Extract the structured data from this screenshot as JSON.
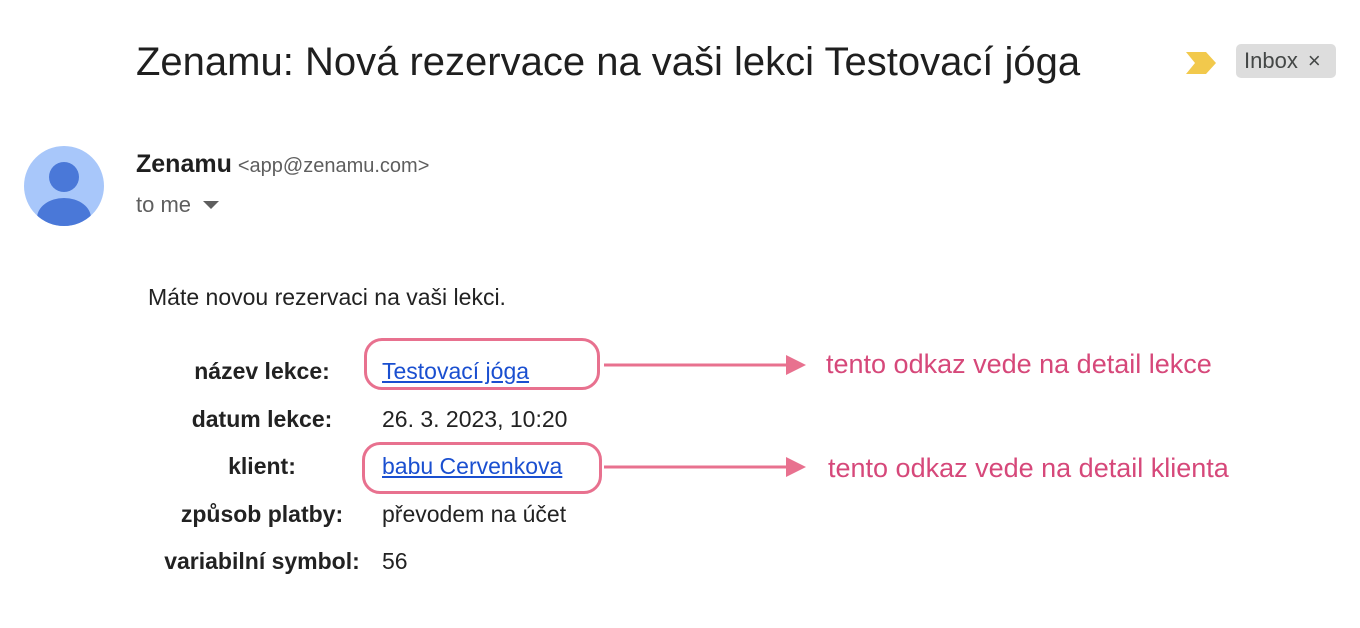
{
  "email": {
    "subject": "Zenamu: Nová rezervace na vaši lekci Testovací jóga",
    "label_chip": {
      "text": "Inbox",
      "close": "×"
    },
    "sender": {
      "name": "Zenamu",
      "email": "<app@zenamu.com>"
    },
    "recipient": "to me",
    "body": {
      "intro": "Máte novou rezervaci na vaši lekci.",
      "details": [
        {
          "label": "název lekce:",
          "value": "Testovací jóga",
          "link": true
        },
        {
          "label": "datum lekce:",
          "value": "26. 3. 2023, 10:20",
          "link": false
        },
        {
          "label": "klient:",
          "value": "babu Cervenkova",
          "link": true
        },
        {
          "label": "způsob platby:",
          "value": "převodem na účet",
          "link": false
        },
        {
          "label": "variabilní symbol:",
          "value": "56",
          "link": false
        }
      ]
    }
  },
  "annotations": {
    "lesson_note": "tento odkaz vede na detail lekce",
    "client_note": "tento odkaz vede na detail klienta",
    "color": "#e8718f",
    "text_color": "#d6487a"
  },
  "icons": {
    "importance_marker": "importance-marker-icon",
    "avatar": "person-avatar-icon",
    "dropdown": "caret-down-icon"
  },
  "colors": {
    "avatar_bg": "#a8c7fa",
    "avatar_figure": "#4a78d8",
    "importance": "#f2c94c",
    "link": "#1a4fd0",
    "chip_bg": "#dddddd"
  }
}
